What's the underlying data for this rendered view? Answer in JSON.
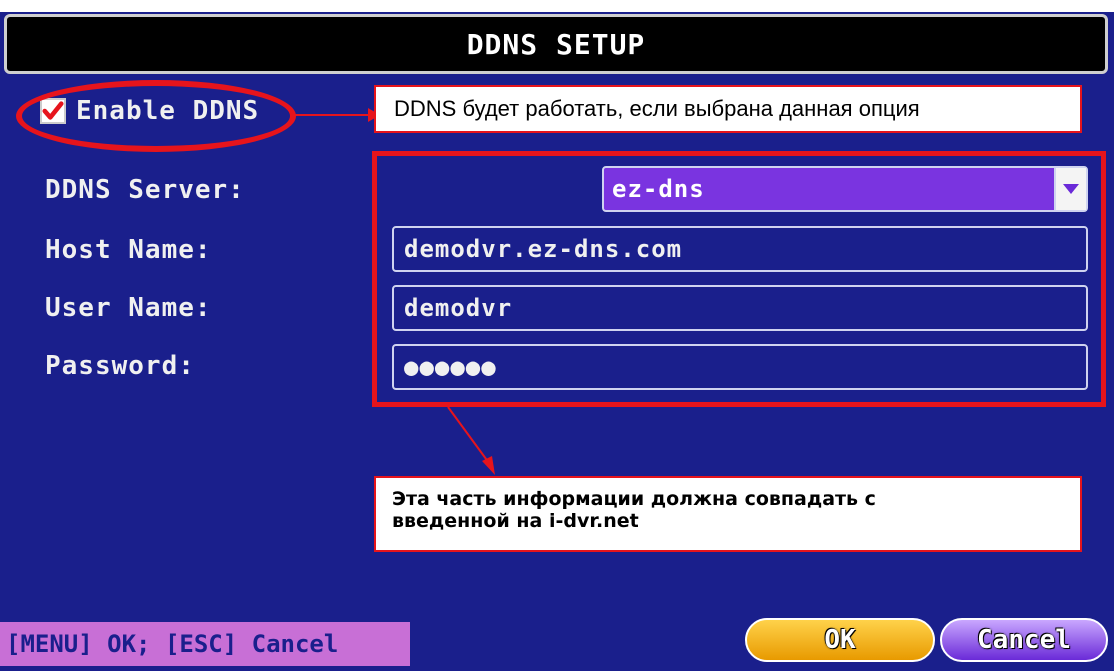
{
  "window": {
    "title": "DDNS SETUP"
  },
  "enable": {
    "label": "Enable DDNS",
    "checked": true
  },
  "annotations": {
    "enable_note": "DDNS будет работать, если выбрана данная опция",
    "form_note_line1": "Эта часть информации должна совпадать с",
    "form_note_line2": "введенной на i-dvr.net"
  },
  "form": {
    "server": {
      "label": "DDNS Server:",
      "value": "ez-dns"
    },
    "host": {
      "label": "Host Name:",
      "value": "demodvr.ez-dns.com"
    },
    "user": {
      "label": "User Name:",
      "value": "demodvr"
    },
    "password": {
      "label": "Password:",
      "value": "●●●●●●"
    }
  },
  "footer": {
    "hint": "[MENU] OK; [ESC] Cancel",
    "ok_label": "OK",
    "cancel_label": "Cancel"
  },
  "colors": {
    "background": "#1a1f8c",
    "annotation_red": "#e6141c",
    "select_purple": "#7a34e0",
    "ok_yellow": "#f0b020",
    "cancel_purple": "#8a4ae6",
    "hint_pink": "#c86fd6"
  },
  "icons": {
    "checkbox": "checkmark-icon",
    "dropdown": "chevron-down-icon"
  }
}
